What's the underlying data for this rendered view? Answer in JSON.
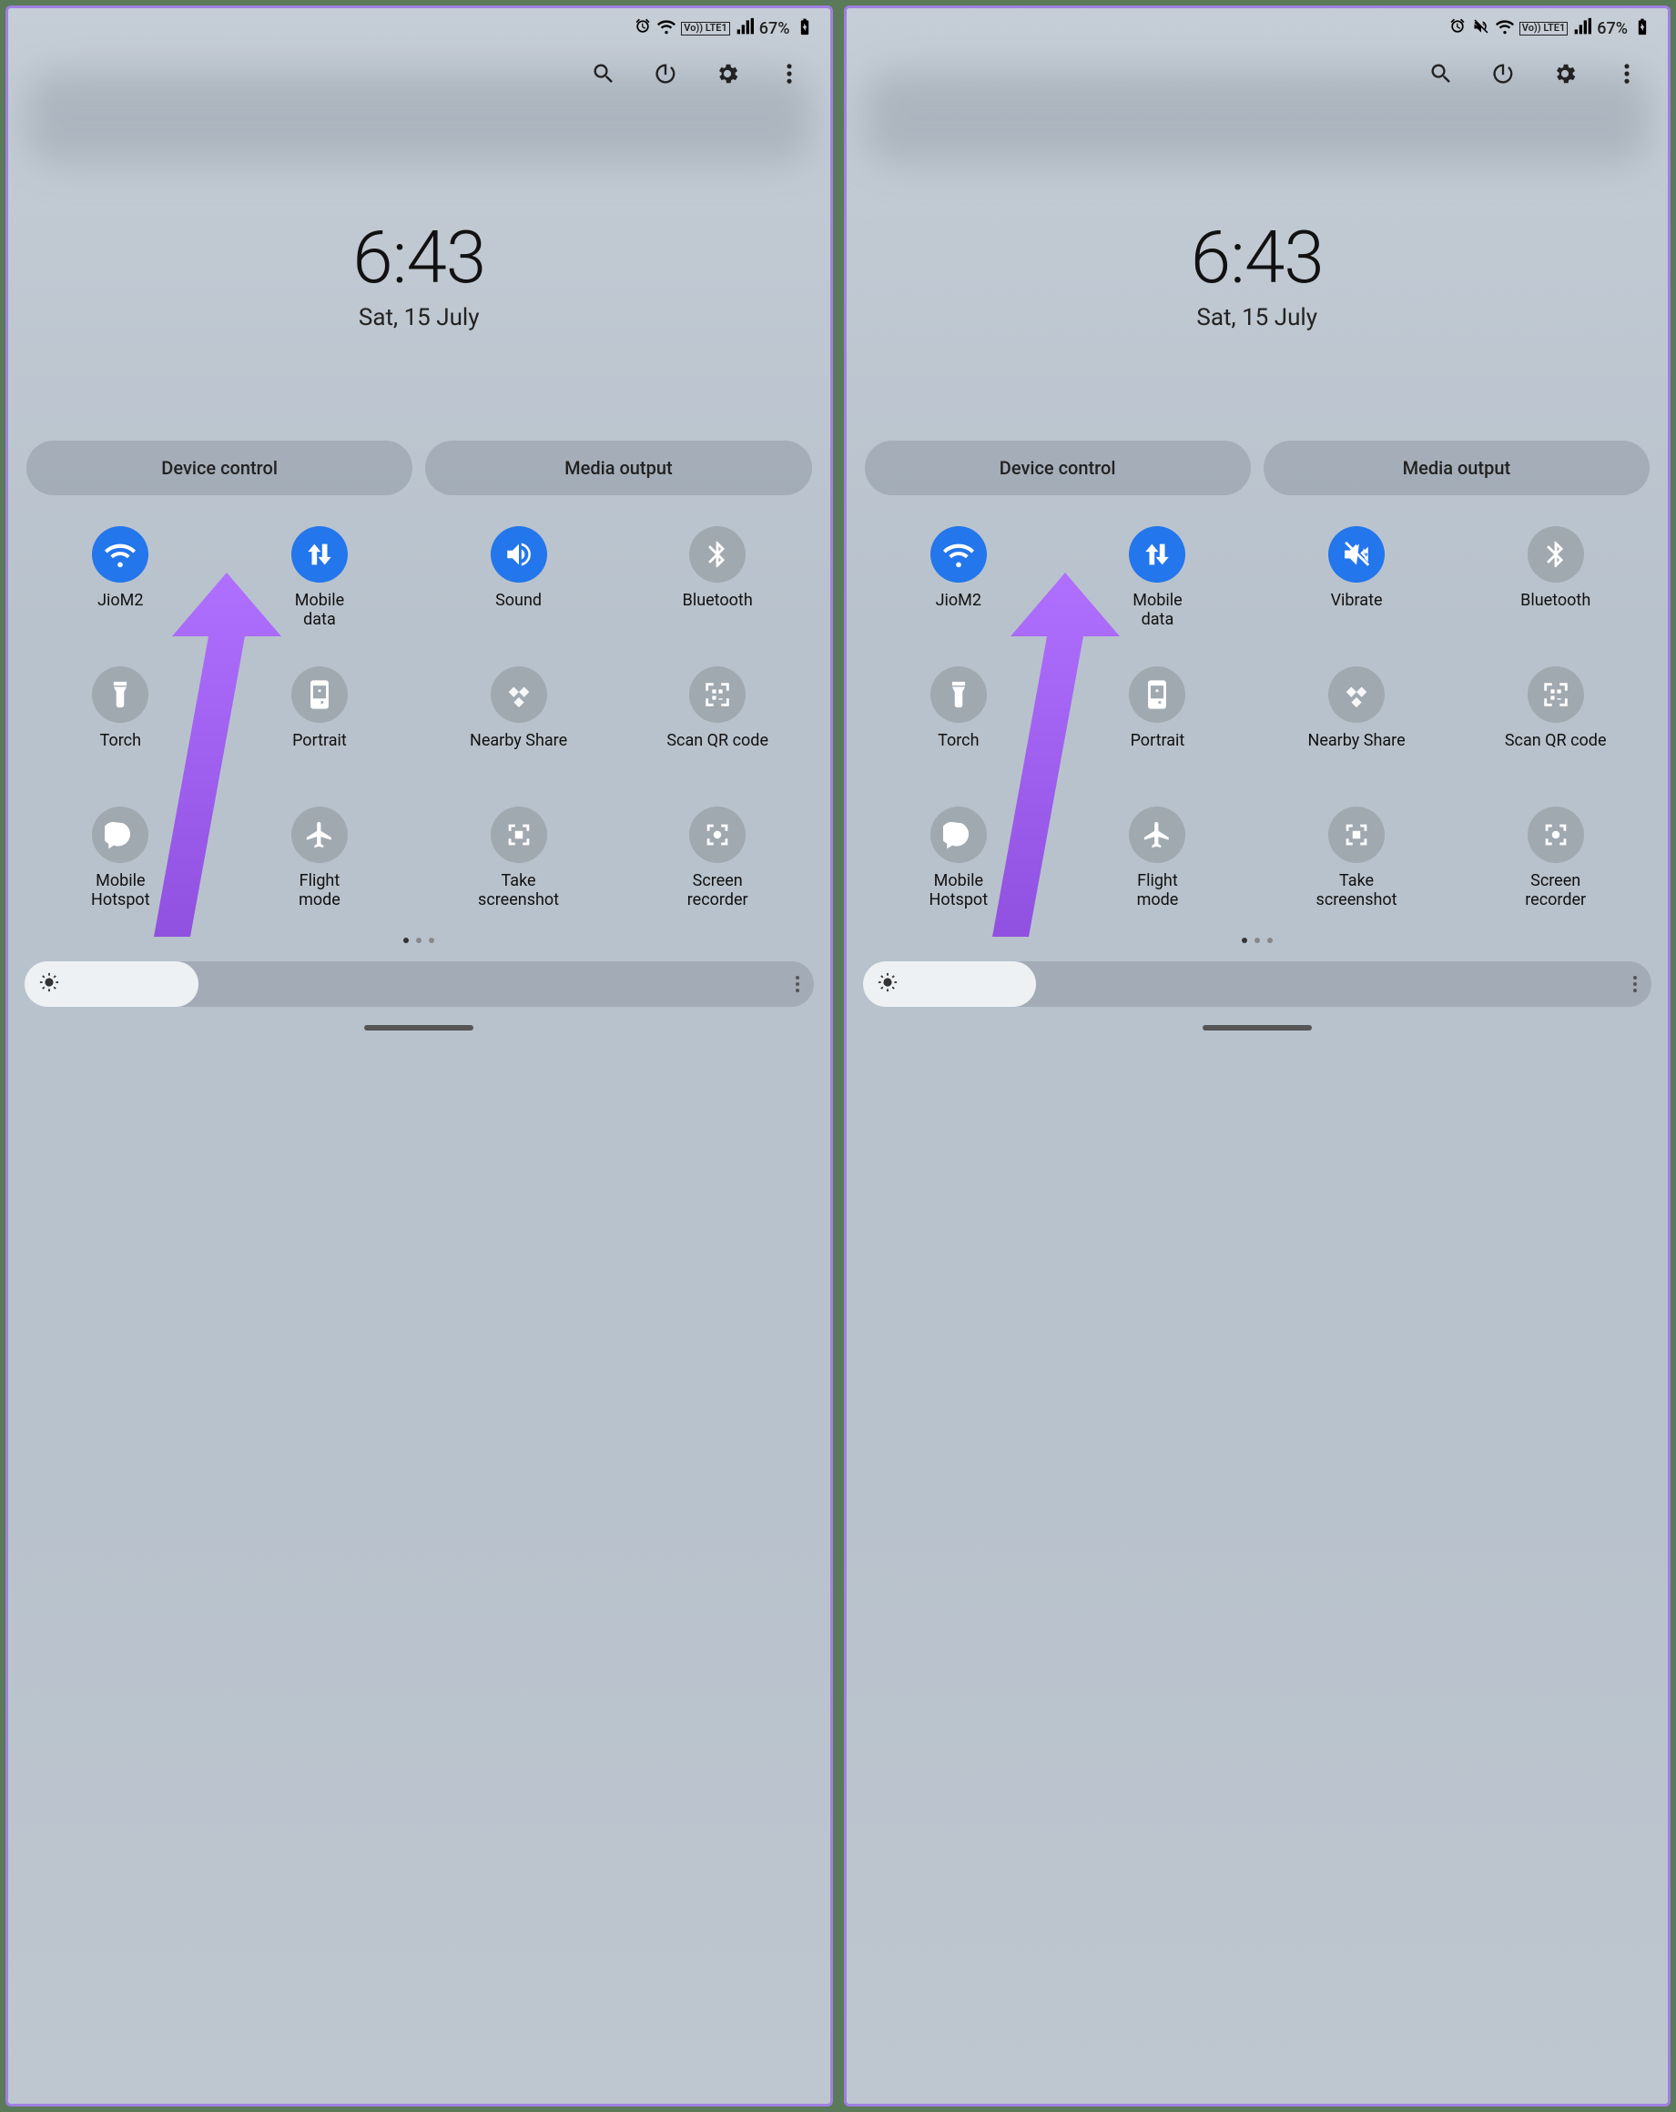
{
  "status": {
    "battery_text": "67%",
    "lte_label": "Vo))\nLTE1"
  },
  "clock": {
    "time": "6:43",
    "date": "Sat, 15 July"
  },
  "pills": {
    "device_control": "Device control",
    "media_output": "Media output"
  },
  "left": {
    "sound_tile_label": "Sound"
  },
  "right": {
    "sound_tile_label": "Vibrate"
  },
  "tiles": {
    "wifi": "JioM2",
    "mobile_data": "Mobile\ndata",
    "bluetooth": "Bluetooth",
    "torch": "Torch",
    "portrait": "Portrait",
    "nearby_share": "Nearby Share",
    "scan_qr": "Scan QR code",
    "hotspot": "Mobile\nHotspot",
    "flight": "Flight\nmode",
    "screenshot": "Take\nscreenshot",
    "recorder": "Screen\nrecorder"
  }
}
